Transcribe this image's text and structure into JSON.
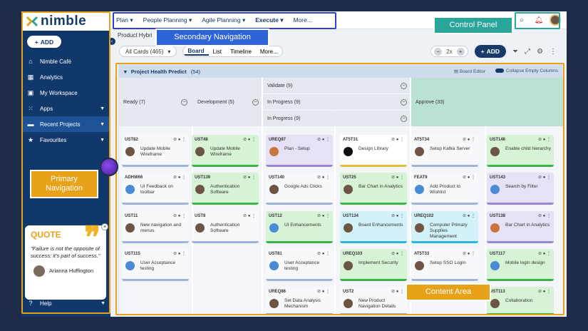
{
  "app": {
    "name": "nimble"
  },
  "sidebar": {
    "add_label": "ADD",
    "items": [
      {
        "label": "Nimble Café",
        "icon": "home-icon"
      },
      {
        "label": "Analytics",
        "icon": "chart-icon"
      },
      {
        "label": "My Workspace",
        "icon": "workspace-icon"
      },
      {
        "label": "Apps",
        "icon": "grid-icon"
      },
      {
        "label": "Recent Projects",
        "icon": "projects-icon"
      },
      {
        "label": "Favourites",
        "icon": "star-icon"
      }
    ],
    "help_label": "Help"
  },
  "quote": {
    "title": "QUOTE",
    "text": "\"Failure is not the opposite of success; it's part of success.\"",
    "author": "Arianna Huffington"
  },
  "topnav": {
    "items": [
      "Plan",
      "People Planning",
      "Agile Planning",
      "Execute",
      "More..."
    ]
  },
  "breadcrumb": {
    "project": "Product Hybri"
  },
  "toolbar": {
    "filter": "All Cards (465)",
    "views": [
      "Board",
      "List",
      "Timeline",
      "More..."
    ],
    "zoom": "2x",
    "add_label": "ADD"
  },
  "board": {
    "title": "Project Health Predict",
    "count": "(54)",
    "board_editor": "Board Editor",
    "collapse_empty": "Collapse Empty Columns",
    "columns": [
      {
        "label": "Ready (7)"
      },
      {
        "label": "Development (5)"
      },
      {
        "label": "Validate (9)"
      },
      {
        "label": "In Progress (9)"
      },
      {
        "label": "In Progress (9)"
      },
      {
        "label": "Approve (33)"
      }
    ],
    "cards": [
      {
        "id": "UST82",
        "title": "Update Mobile Wireframe"
      },
      {
        "id": "ADHW66",
        "title": "UI Feedback on toolbar"
      },
      {
        "id": "UST11",
        "title": "New navigation and menus"
      },
      {
        "id": "UST115",
        "title": "User Acceptance testing"
      },
      {
        "id": "UST48",
        "title": "Update Mobile Wireframe"
      },
      {
        "id": "UST139",
        "title": "Authentication Software"
      },
      {
        "id": "UST8",
        "title": "Authentication Software"
      },
      {
        "id": "UREQ87",
        "title": "Plan - Setup"
      },
      {
        "id": "UST140",
        "title": "Google Ads Clicks"
      },
      {
        "id": "UST12",
        "title": "UI Enhancements"
      },
      {
        "id": "UST81",
        "title": "User Acceptance testing"
      },
      {
        "id": "UREQ86",
        "title": "Set Data Analysis Mechanism"
      },
      {
        "id": "AT5T31",
        "title": "Design Library"
      },
      {
        "id": "UST25",
        "title": "Bar Chart in Analytics"
      },
      {
        "id": "UST134",
        "title": "Board Enhancements"
      },
      {
        "id": "UREQ103",
        "title": "Implement Security"
      },
      {
        "id": "UST2",
        "title": "New Product Navigation Details"
      },
      {
        "id": "AT5T34",
        "title": "Setup Kafka Server"
      },
      {
        "id": "FEAT9",
        "title": "Add Product to Wishlist"
      },
      {
        "id": "UREQ102",
        "title": "Computer Primary Supplies Management"
      },
      {
        "id": "AT5T33",
        "title": "Setup SSO Login"
      },
      {
        "id": "UST146",
        "title": "Enable child hierarchy"
      },
      {
        "id": "UST143",
        "title": "Search by Filter"
      },
      {
        "id": "UST138",
        "title": "Bar Chart in Analytics"
      },
      {
        "id": "UST117",
        "title": "Mobile login design"
      },
      {
        "id": "UST113",
        "title": "Collaboration"
      }
    ]
  },
  "annotations": {
    "secondary_navigation": "Secondary Navigation",
    "control_panel": "Control Panel",
    "primary_navigation": "Primary Navigation",
    "content_area": "Content Area"
  },
  "colors": {
    "navy": "#10386b",
    "orange": "#e8a21a",
    "blue_tag": "#2f63d8",
    "teal": "#2aa59a"
  }
}
